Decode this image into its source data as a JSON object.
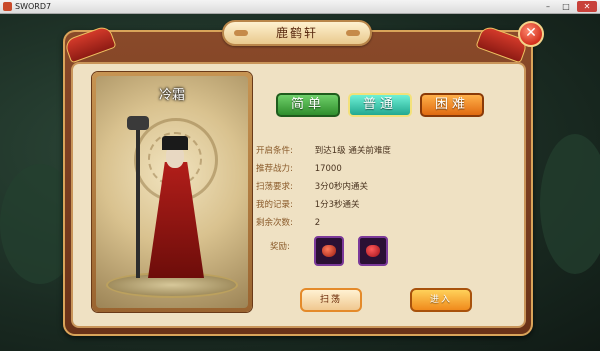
{
  "window": {
    "title": "SWORD7",
    "minimize": "–",
    "maximize": "□",
    "close": "✕"
  },
  "dialog": {
    "title": "鹿鹤轩",
    "close_icon": "✕"
  },
  "character": {
    "name": "冷霜"
  },
  "difficulty": {
    "easy": "简单",
    "normal": "普通",
    "hard": "困难",
    "selected": "普通"
  },
  "info": [
    {
      "label": "开启条件:",
      "value": "到达1级  通关前难度"
    },
    {
      "label": "推荐战力:",
      "value": "17000"
    },
    {
      "label": "扫荡要求:",
      "value": "3分0秒内通关"
    },
    {
      "label": "我的记录:",
      "value": "1分3秒通关"
    },
    {
      "label": "剩余次数:",
      "value": "2"
    }
  ],
  "rewards": {
    "label": "奖励:",
    "items": [
      "reward-gem-icon",
      "reward-ruby-icon"
    ]
  },
  "buttons": {
    "sweep": "扫荡",
    "enter": "进入"
  }
}
